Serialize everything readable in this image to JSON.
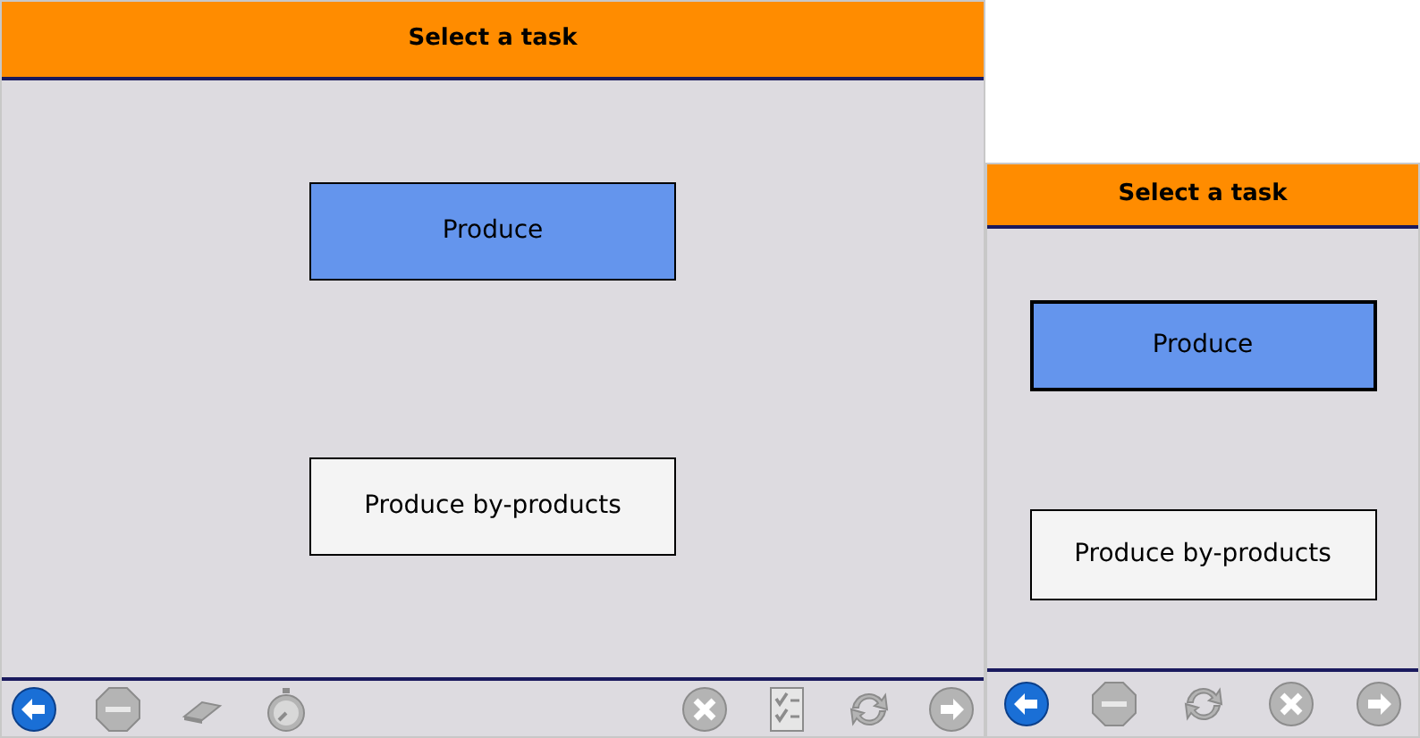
{
  "screens": [
    {
      "title": "Select a task",
      "tasks": [
        {
          "label": "Produce",
          "selected": true
        },
        {
          "label": "Produce by-products",
          "selected": false
        }
      ],
      "toolbar": {
        "left": [
          {
            "kind": "back",
            "disabled": false
          },
          {
            "kind": "stop",
            "disabled": true
          },
          {
            "kind": "eraser",
            "disabled": true
          },
          {
            "kind": "stopwatch",
            "disabled": true
          }
        ],
        "right": [
          {
            "kind": "cancel",
            "disabled": true
          },
          {
            "kind": "checklist",
            "disabled": true
          },
          {
            "kind": "refresh",
            "disabled": true
          },
          {
            "kind": "forward",
            "disabled": true
          }
        ]
      }
    },
    {
      "title": "Select a task",
      "tasks": [
        {
          "label": "Produce",
          "selected": true
        },
        {
          "label": "Produce by-products",
          "selected": false
        }
      ],
      "toolbar": {
        "left": [
          {
            "kind": "back",
            "disabled": false
          },
          {
            "kind": "stop",
            "disabled": true
          },
          {
            "kind": "refresh",
            "disabled": true
          },
          {
            "kind": "cancel",
            "disabled": true
          },
          {
            "kind": "forward",
            "disabled": true
          }
        ]
      }
    }
  ]
}
